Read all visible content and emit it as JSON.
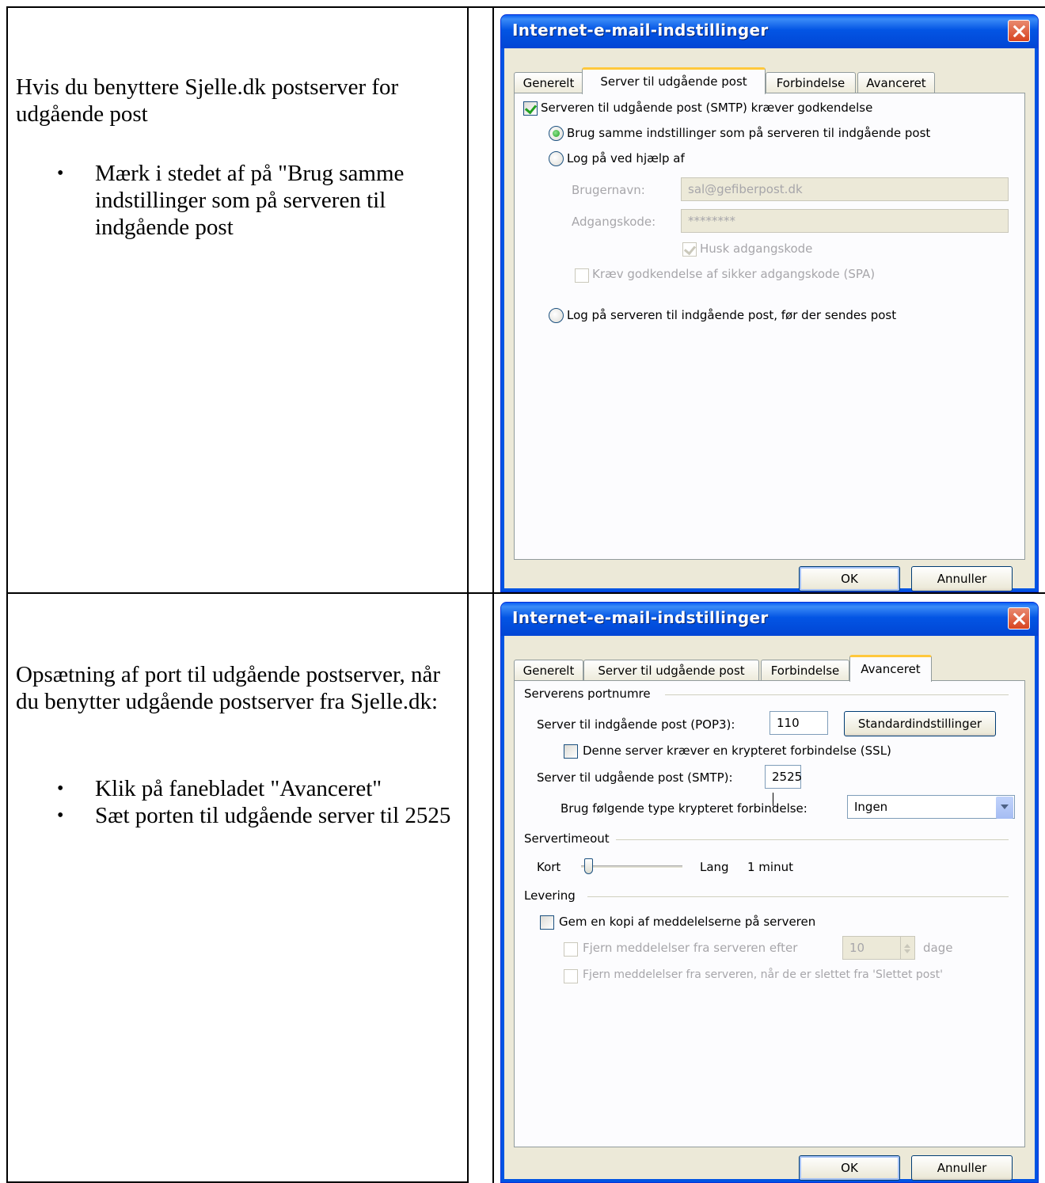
{
  "section1": {
    "instruction": "Hvis du benyttere Sjelle.dk postserver for udgående post",
    "bullets": [
      "Mærk i stedet af på  \"Brug samme indstillinger som på serveren til indgående post"
    ]
  },
  "section2": {
    "instruction": "Opsætning af port til udgående postserver, når du benytter udgående postserver fra Sjelle.dk:",
    "bullets": [
      "Klik på fanebladet \"Avanceret\"",
      "Sæt porten til udgående server til 2525"
    ]
  },
  "dialog1": {
    "title": "Internet-e-mail-indstillinger",
    "tabs": [
      "Generelt",
      "Server til udgående post",
      "Forbindelse",
      "Avanceret"
    ],
    "active_tab": "Server til udgående post",
    "smtp_auth_label": "Serveren til udgående post (SMTP) kræver godkendelse",
    "smtp_auth_checked": true,
    "radio_same_label": "Brug samme indstillinger som på serveren til indgående post",
    "radio_logon_label": "Log på ved hjælp af",
    "username_label": "Brugernavn:",
    "username_value": "sal@gefiberpost.dk",
    "password_label": "Adgangskode:",
    "password_value": "********",
    "remember_label": "Husk adgangskode",
    "spa_label": "Kræv godkendelse af sikker adgangskode (SPA)",
    "radio_incoming_label": "Log på serveren til indgående post, før der sendes post",
    "ok_label": "OK",
    "cancel_label": "Annuller"
  },
  "dialog2": {
    "title": "Internet-e-mail-indstillinger",
    "tabs": [
      "Generelt",
      "Server til udgående post",
      "Forbindelse",
      "Avanceret"
    ],
    "active_tab": "Avanceret",
    "ports_group": "Serverens portnumre",
    "pop3_label": "Server til indgående post (POP3):",
    "pop3_value": "110",
    "defaults_button": "Standardindstillinger",
    "ssl_label": "Denne server kræver en krypteret forbindelse (SSL)",
    "smtp_label": "Server til udgående post (SMTP):",
    "smtp_value": "2525",
    "encryption_label": "Brug følgende type krypteret forbindelse:",
    "encryption_value": "Ingen",
    "timeout_group": "Servertimeout",
    "timeout_short": "Kort",
    "timeout_long": "Lang",
    "timeout_value": "1 minut",
    "delivery_group": "Levering",
    "keep_copy_label": "Gem en kopi af meddelelserne på serveren",
    "remove_after_label": "Fjern meddelelser fra serveren efter",
    "remove_days_value": "10",
    "days_label": "dage",
    "remove_deleted_label": "Fjern meddelelser fra serveren, når de er slettet fra 'Slettet post'",
    "ok_label": "OK",
    "cancel_label": "Annuller"
  }
}
